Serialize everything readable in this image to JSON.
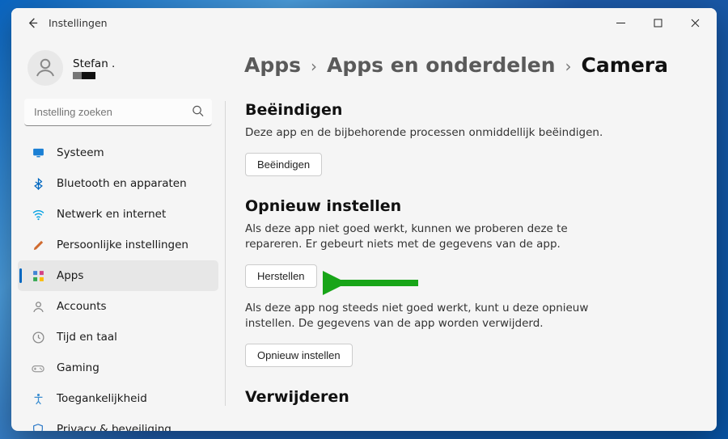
{
  "window": {
    "title": "Instellingen"
  },
  "profile": {
    "name": "Stefan ."
  },
  "search": {
    "placeholder": "Instelling zoeken"
  },
  "sidebar": {
    "items": [
      {
        "icon": "monitor",
        "label": "Systeem",
        "color": "#1a7fd4"
      },
      {
        "icon": "bluetooth",
        "label": "Bluetooth en apparaten",
        "color": "#0067c0"
      },
      {
        "icon": "wifi",
        "label": "Netwerk en internet",
        "color": "#00a0e3"
      },
      {
        "icon": "brush",
        "label": "Persoonlijke instellingen",
        "color": "#d06a2f"
      },
      {
        "icon": "apps",
        "label": "Apps",
        "color": "#444",
        "active": true
      },
      {
        "icon": "account",
        "label": "Accounts",
        "color": "#888"
      },
      {
        "icon": "clock",
        "label": "Tijd en taal",
        "color": "#8a8a8a"
      },
      {
        "icon": "gaming",
        "label": "Gaming",
        "color": "#9a9a9a"
      },
      {
        "icon": "access",
        "label": "Toegankelijkheid",
        "color": "#3a8dd0"
      },
      {
        "icon": "shield",
        "label": "Privacy & beveiliging",
        "color": "#2a78c7"
      }
    ]
  },
  "breadcrumb": {
    "items": [
      "Apps",
      "Apps en onderdelen",
      "Camera"
    ]
  },
  "sections": {
    "terminate": {
      "heading": "Beëindigen",
      "desc": "Deze app en de bijbehorende processen onmiddellijk beëindigen.",
      "button": "Beëindigen"
    },
    "reset": {
      "heading": "Opnieuw instellen",
      "desc1": "Als deze app niet goed werkt, kunnen we proberen deze te repareren. Er gebeurt niets met de gegevens van de app.",
      "button1": "Herstellen",
      "desc2": "Als deze app nog steeds niet goed werkt, kunt u deze opnieuw instellen. De gegevens van de app worden verwijderd.",
      "button2": "Opnieuw instellen"
    },
    "uninstall": {
      "heading": "Verwijderen"
    }
  }
}
